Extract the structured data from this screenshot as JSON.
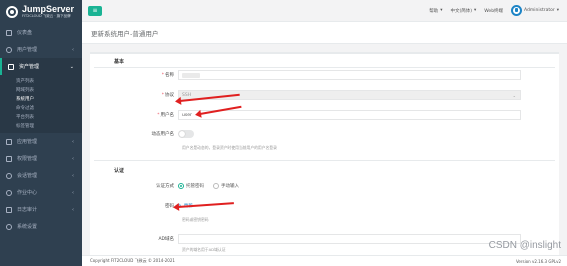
{
  "app": {
    "title": "JumpServer",
    "subtitle": "FIT2CLOUD 飞致云 · 旗下品牌"
  },
  "sidebar": {
    "items": [
      {
        "label": "仪表盘",
        "icon": "dashboard-icon"
      },
      {
        "label": "用户管理",
        "icon": "users-icon"
      },
      {
        "label": "资产管理",
        "icon": "inbox-icon",
        "active": true
      },
      {
        "label": "应用管理",
        "icon": "apps-icon"
      },
      {
        "label": "权限管理",
        "icon": "lock-icon"
      },
      {
        "label": "会话管理",
        "icon": "sessions-icon"
      },
      {
        "label": "作业中心",
        "icon": "tasks-icon"
      },
      {
        "label": "日志审计",
        "icon": "audit-icon"
      },
      {
        "label": "系统设置",
        "icon": "gear-icon"
      }
    ],
    "submenu": [
      "资产列表",
      "网域列表",
      "系统用户",
      "命令过滤",
      "平台列表",
      "标签管理"
    ]
  },
  "topbar": {
    "help": "帮助",
    "language": "中文(简体)",
    "web_terminal": "Web终端",
    "user": "Administrator"
  },
  "page": {
    "title": "更新系统用户-普通用户"
  },
  "form": {
    "basic_section": "基本",
    "name_label": "名称",
    "protocol_label": "协议",
    "protocol_value": "SSH",
    "username_label": "用户名",
    "username_value": "user",
    "dynamic_user_label": "动态用户名",
    "dynamic_user_help": "用户名是动态的，登录资产时使用当前用户的用户名登录",
    "auth_section": "认证",
    "auth_method_label": "认证方式",
    "auth_option_password": "托管密码",
    "auth_option_manual": "手动输入",
    "password_label": "密码",
    "password_update": "更新",
    "password_help": "密码或密钥密码",
    "ad_label": "AD域名",
    "ad_help": "资产的域名用于AD域认证"
  },
  "footer": {
    "copyright": "Copyright FIT2CLOUD 飞致云 © 2014-2021",
    "version": "Version v2.16.3 GPLv2"
  },
  "watermark": "CSDN @inslight"
}
